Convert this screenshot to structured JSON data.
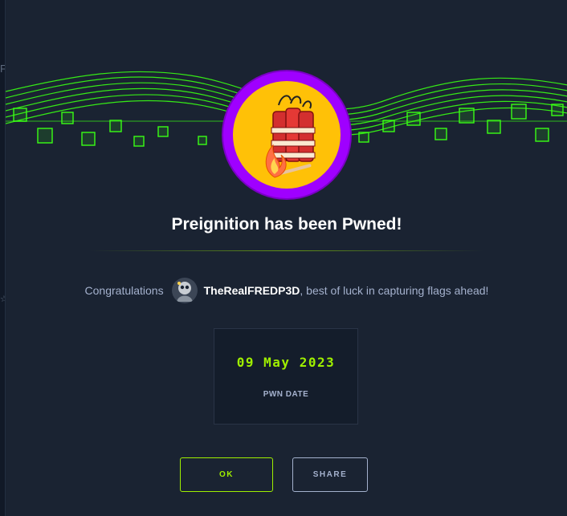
{
  "backdrop": {
    "edge_text": "F",
    "edge_star": "☆"
  },
  "modal": {
    "title": "Preignition has been Pwned!",
    "congrats_prefix": "Congratulations",
    "username": "TheRealFREDP3D",
    "congrats_suffix": ", best of luck in capturing flags ahead!",
    "pwn_date": {
      "value": "09 May 2023",
      "label": "PWN DATE"
    },
    "buttons": {
      "ok_label": "OK",
      "share_label": "SHARE"
    }
  },
  "badge": {
    "icon": "dynamite-icon",
    "ring_color": "#9f00ff",
    "fill_color": "#ffc107"
  },
  "colors": {
    "accent": "#9fef00",
    "background": "#1a2332",
    "text_muted": "#a4b1cd"
  }
}
